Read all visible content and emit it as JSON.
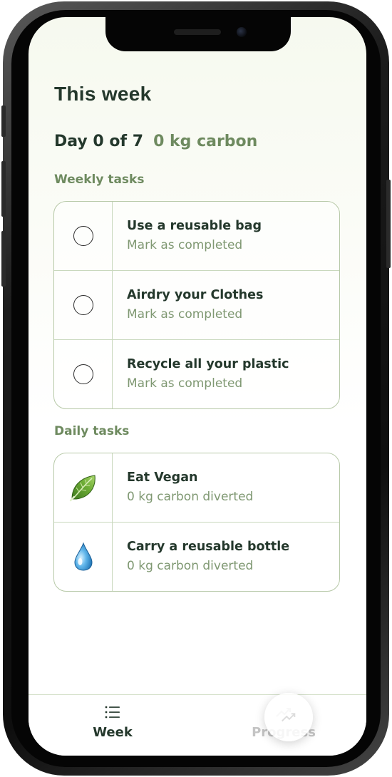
{
  "header": {
    "title": "This week"
  },
  "summary": {
    "day_text": "Day 0 of 7",
    "carbon_text": "0 kg carbon"
  },
  "weekly": {
    "label": "Weekly tasks",
    "tasks": [
      {
        "title": "Use a reusable bag",
        "subtitle": "Mark as completed"
      },
      {
        "title": "Airdry your Clothes",
        "subtitle": "Mark as completed"
      },
      {
        "title": "Recycle all your plastic",
        "subtitle": "Mark as completed"
      }
    ]
  },
  "daily": {
    "label": "Daily tasks",
    "tasks": [
      {
        "title": "Eat Vegan",
        "subtitle": "0 kg carbon diverted",
        "icon": "leaf-icon"
      },
      {
        "title": "Carry a reusable bottle",
        "subtitle": "0 kg carbon diverted",
        "icon": "water-drop-icon"
      }
    ]
  },
  "tabs": {
    "week": {
      "label": "Week",
      "icon": "list-icon"
    },
    "progress": {
      "label": "Progress",
      "icon": "trending-up-icon"
    }
  },
  "colors": {
    "primary_text": "#24382c",
    "accent_green": "#6e8a5f",
    "border": "#b7c9a8"
  }
}
